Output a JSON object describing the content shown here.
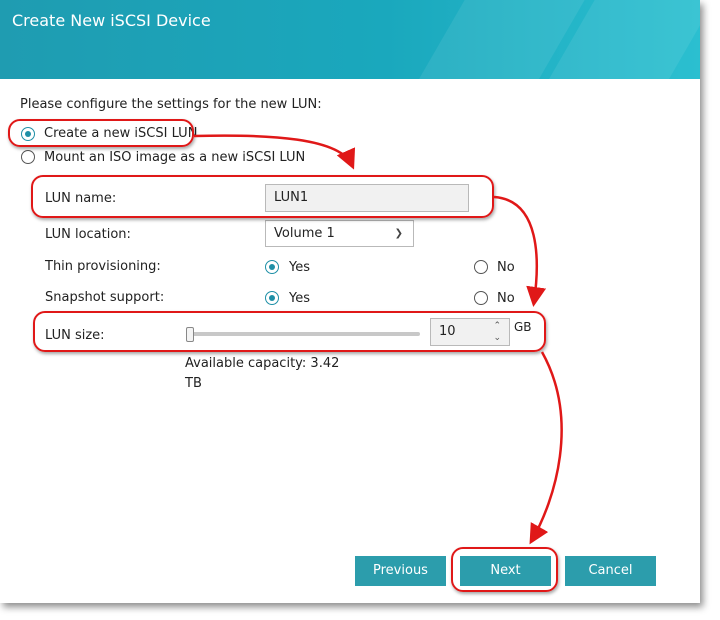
{
  "window": {
    "title": "Create New iSCSI Device"
  },
  "intro": "Please configure the settings for the new LUN:",
  "options": {
    "create_lun": "Create a new iSCSI LUN",
    "mount_iso": "Mount an ISO image as a new iSCSI LUN"
  },
  "form": {
    "lun_name_label": "LUN name:",
    "lun_name_value": "LUN1",
    "lun_location_label": "LUN location:",
    "lun_location_value": "Volume 1",
    "thin_label": "Thin provisioning:",
    "snapshot_label": "Snapshot support:",
    "yes": "Yes",
    "no": "No",
    "lun_size_label": "LUN size:",
    "lun_size_value": "10",
    "lun_size_unit": "GB",
    "available_line1": "Available capacity: 3.42",
    "available_line2": "TB"
  },
  "buttons": {
    "previous": "Previous",
    "next": "Next",
    "cancel": "Cancel"
  },
  "colors": {
    "accent": "#2c9dac",
    "annotation": "#e01818"
  }
}
